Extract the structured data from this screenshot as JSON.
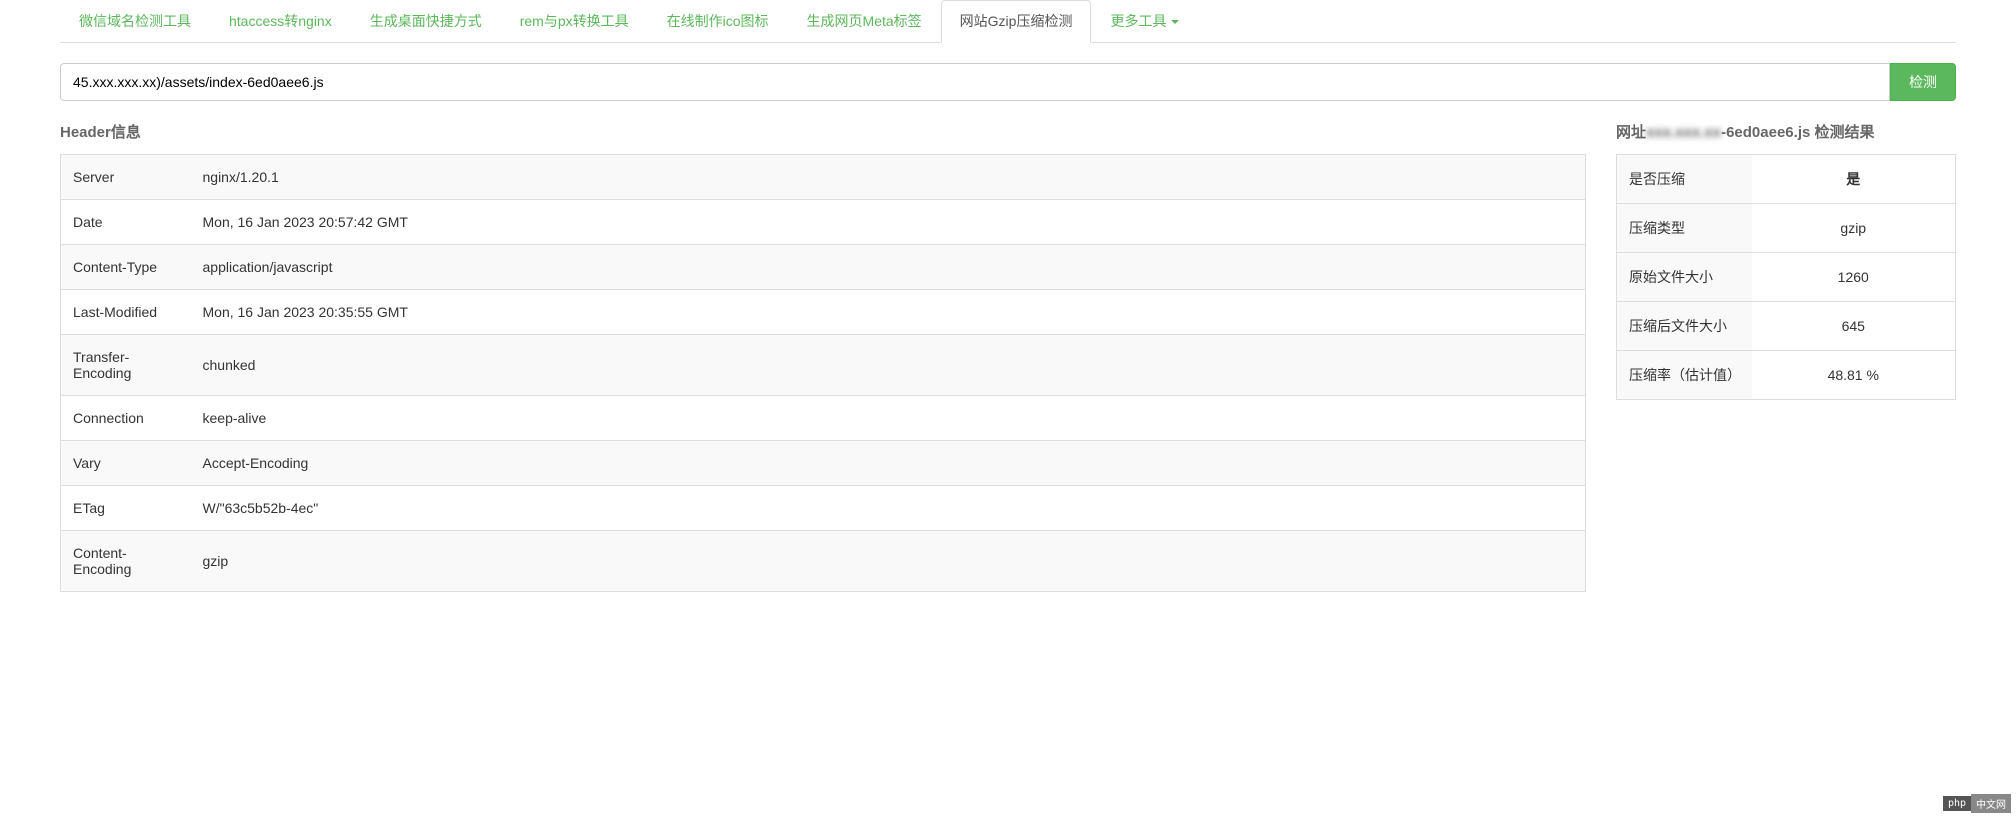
{
  "tabs": [
    {
      "label": "微信域名检测工具",
      "active": false
    },
    {
      "label": "htaccess转nginx",
      "active": false
    },
    {
      "label": "生成桌面快捷方式",
      "active": false
    },
    {
      "label": "rem与px转换工具",
      "active": false
    },
    {
      "label": "在线制作ico图标",
      "active": false
    },
    {
      "label": "生成网页Meta标签",
      "active": false
    },
    {
      "label": "网站Gzip压缩检测",
      "active": true
    },
    {
      "label": "更多工具",
      "active": false,
      "caret": true
    }
  ],
  "input": {
    "value_prefix": "45.xxx.xxx.xx",
    "value_suffix": ")/assets/index-6ed0aee6.js"
  },
  "check_button": "检测",
  "left": {
    "title": "Header信息",
    "rows": [
      {
        "key": "Server",
        "value": "nginx/1.20.1"
      },
      {
        "key": "Date",
        "value": "Mon, 16 Jan 2023 20:57:42 GMT"
      },
      {
        "key": "Content-Type",
        "value": "application/javascript"
      },
      {
        "key": "Last-Modified",
        "value": "Mon, 16 Jan 2023 20:35:55 GMT"
      },
      {
        "key": "Transfer-Encoding",
        "value": "chunked"
      },
      {
        "key": "Connection",
        "value": "keep-alive"
      },
      {
        "key": "Vary",
        "value": "Accept-Encoding"
      },
      {
        "key": "ETag",
        "value": "W/\"63c5b52b-4ec\""
      },
      {
        "key": "Content-Encoding",
        "value": "gzip"
      }
    ]
  },
  "right": {
    "title_prefix": "网址",
    "title_mid_blur": "xxx.xxx.xx",
    "title_suffix": "-6ed0aee6.js 检测结果",
    "rows": [
      {
        "key": "是否压缩",
        "value": "是",
        "highlight": true
      },
      {
        "key": "压缩类型",
        "value": "gzip"
      },
      {
        "key": "原始文件大小",
        "value": "1260"
      },
      {
        "key": "压缩后文件大小",
        "value": "645"
      },
      {
        "key": "压缩率（估计值）",
        "value": "48.81 %"
      }
    ]
  },
  "watermark": {
    "p1": "php",
    "p2": "中文网"
  }
}
